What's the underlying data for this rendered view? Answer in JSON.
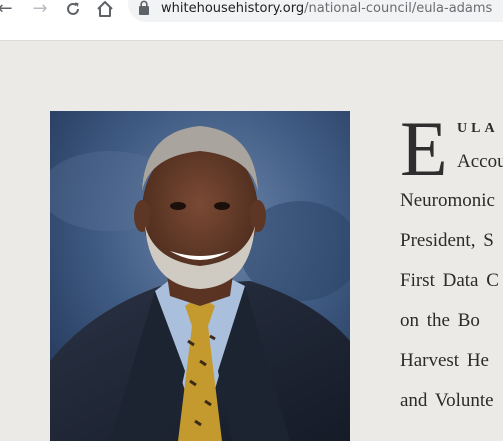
{
  "browser": {
    "url_host": "whitehousehistory.org",
    "url_path": "/national-council/eula-adams",
    "icons": {
      "back": "arrow-left-icon",
      "forward": "arrow-right-icon",
      "reload": "reload-icon",
      "home": "home-icon",
      "secure": "lock-icon"
    }
  },
  "profile": {
    "portrait_alt": "Portrait of Eula Adams",
    "dropcap": "E",
    "name_rest": "ULA",
    "lines": [
      "Accou",
      "Neuromonic",
      "President, S",
      "First Data C",
      "on  the  Bo",
      "Harvest  He",
      "and  Volunte"
    ]
  },
  "colors": {
    "page_bg": "#ebeae7",
    "text": "#2b2b2b",
    "toolbar_bg": "#ffffff",
    "omnibox_bg": "#f1f3f4"
  }
}
